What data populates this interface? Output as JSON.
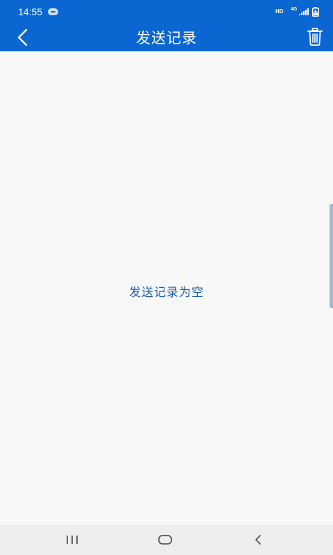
{
  "status_bar": {
    "time": "14:55",
    "hd_label": "HD",
    "network_label": "4G",
    "icons": [
      "message-icon",
      "signal-icon",
      "battery-icon"
    ]
  },
  "app_bar": {
    "title": "发送记录",
    "back_icon": "back-arrow-icon",
    "delete_icon": "trash-icon"
  },
  "content": {
    "empty_message": "发送记录为空"
  },
  "nav_bar": {
    "icons": [
      "recent-apps-icon",
      "home-icon",
      "back-icon"
    ]
  },
  "colors": {
    "primary": "#0a66d0",
    "background": "#f8f8f8",
    "empty_text": "#1b5fa8",
    "nav_background": "#eeeeee"
  }
}
